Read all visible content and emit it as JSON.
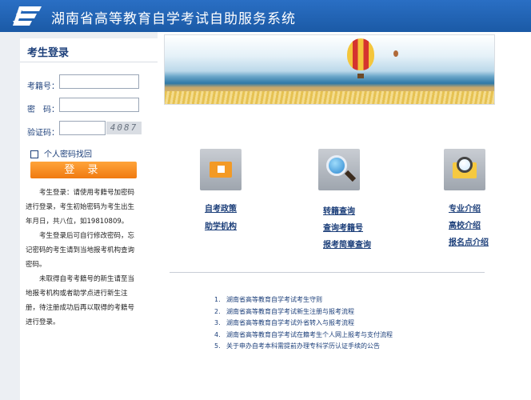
{
  "header": {
    "logo_icon": "e-logo-icon",
    "title": "湖南省高等教育自学考试自助服务系统",
    "color": "#1f63b4"
  },
  "login": {
    "title": "考生登录",
    "id_label": "考籍号：",
    "id_value": "",
    "password_label": "密　码：",
    "password_value": "",
    "captcha_label": "验证码：",
    "captcha_value": "",
    "captcha_image_text": "4087",
    "find_password_label": "个人密码找回",
    "submit_label": "登 录",
    "submit_color": "#f5871f",
    "notes": [
      "考生登录：请使用考籍号加密码进行登录，考生初始密码为考生出生年月日，共八位，如19810809。",
      "考生登录后可自行修改密码，忘记密码的考生请到当地报考机构查询密码。",
      "未取得自考考籍号的新生请至当地报考机构或者助学点进行新生注册，待注册成功后再以取得的考籍号进行登录。"
    ]
  },
  "banner": {
    "icon": "hot-air-balloon-banner-image"
  },
  "columns": [
    {
      "icon": "home-folder-icon",
      "links": [
        "自考政策",
        "助学机构"
      ]
    },
    {
      "icon": "magnifier-icon",
      "links": [
        "转籍查询",
        "查询考籍号",
        "报考简章查询"
      ]
    },
    {
      "icon": "folder-search-icon",
      "links": [
        "专业介绍",
        "高校介绍",
        "报名点介绍"
      ]
    }
  ],
  "news": [
    {
      "num": "1.",
      "text": "湖南省高等教育自学考试考生守则"
    },
    {
      "num": "2.",
      "text": "湖南省高等教育自学考试新生注册与报考流程"
    },
    {
      "num": "3.",
      "text": "湖南省高等教育自学考试外省转入与报考流程"
    },
    {
      "num": "4.",
      "text": "湖南省高等教育自学考试在籍考生个人网上报考与支付流程"
    },
    {
      "num": "5.",
      "text": "关于申办自考本科需提前办理专科学历认证手续的公告"
    }
  ]
}
